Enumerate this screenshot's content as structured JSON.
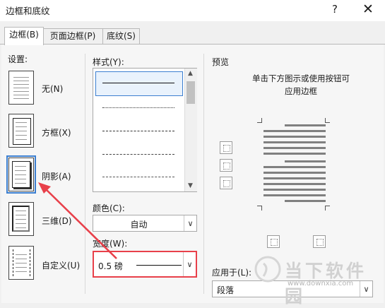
{
  "window": {
    "title": "边框和底纹",
    "help": "?",
    "close": "✕"
  },
  "tabs": [
    {
      "label": "边框(B)",
      "active": true
    },
    {
      "label": "页面边框(P)",
      "active": false
    },
    {
      "label": "底纹(S)",
      "active": false
    }
  ],
  "setting": {
    "label": "设置:",
    "items": [
      {
        "label": "无(N)",
        "icon": "setting-none-icon"
      },
      {
        "label": "方框(X)",
        "icon": "setting-box-icon"
      },
      {
        "label": "阴影(A)",
        "icon": "setting-shadow-icon",
        "selected": true
      },
      {
        "label": "三维(D)",
        "icon": "setting-3d-icon"
      },
      {
        "label": "自定义(U)",
        "icon": "setting-custom-icon"
      }
    ]
  },
  "style": {
    "label": "样式(Y):"
  },
  "color": {
    "label": "颜色(C):",
    "value": "自动"
  },
  "width": {
    "label": "宽度(W):",
    "value": "0.5 磅"
  },
  "preview": {
    "label": "预览",
    "instruction_line1": "单击下方图示或使用按钮可",
    "instruction_line2": "应用边框"
  },
  "apply_to": {
    "label": "应用于(L):",
    "value": "段落"
  },
  "watermark": {
    "brand": "当下软件园",
    "url": "www.downxia.com"
  },
  "annotation": {
    "arrow_color": "#e8404a"
  }
}
